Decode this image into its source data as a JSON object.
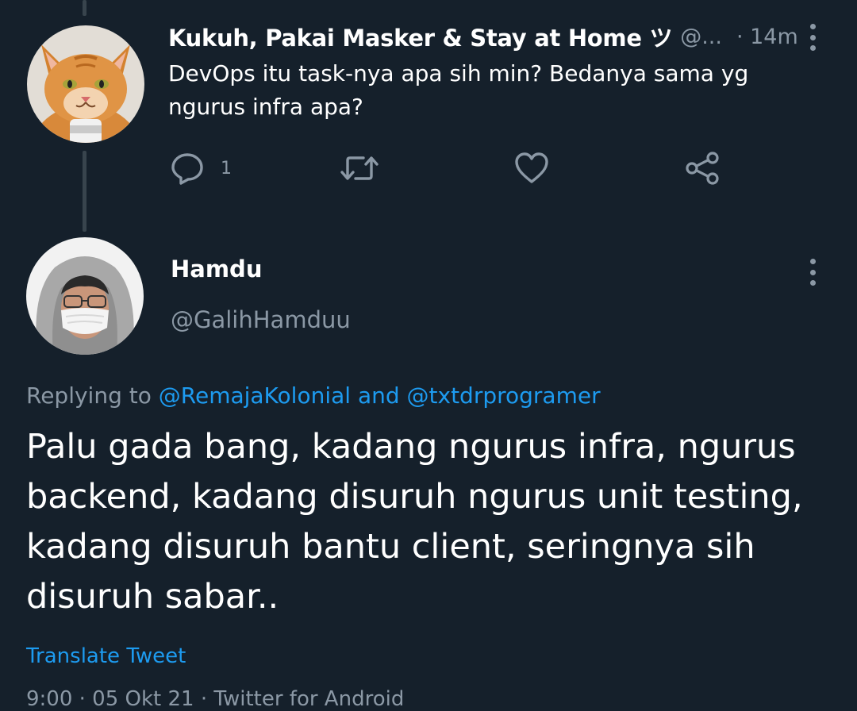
{
  "parent_tweet": {
    "display_name": "Kukuh, Pakai Masker & Stay at Home ツ",
    "handle": "@...",
    "time": "· 14m",
    "text": "DevOps itu task-nya apa sih min? Bedanya sama yg ngurus infra apa?",
    "reply_count": "1",
    "icons": {
      "reply": "reply-bubble-icon",
      "retweet": "retweet-icon",
      "like": "heart-icon",
      "share": "share-icon",
      "more": "more-vertical-icon"
    }
  },
  "main_tweet": {
    "display_name": "Hamdu",
    "handle": "@GalihHamduu",
    "replying_prefix": "Replying to",
    "replying_user1": "@RemajaKolonial",
    "replying_and": "and",
    "replying_user2": "@txtdrprogramer",
    "text": "Palu gada bang, kadang ngurus infra, ngurus backend, kadang disuruh ngurus unit testing, kadang disuruh bantu client, seringnya sih disuruh sabar..",
    "translate_label": "Translate Tweet",
    "meta_partial": "9:00 · 05 Okt 21 · Twitter for Android"
  },
  "colors": {
    "background": "#15202b",
    "primary_text": "#ffffff",
    "secondary_text": "#8b98a5",
    "link": "#1d9bf0",
    "thread_line": "#38444d"
  }
}
